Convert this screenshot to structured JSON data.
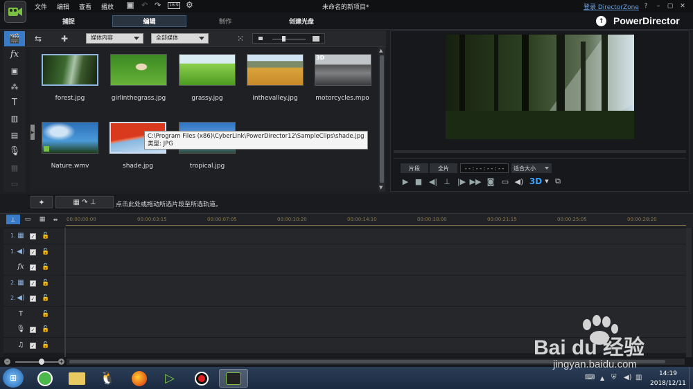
{
  "menu": [
    "文件",
    "编辑",
    "查看",
    "播放"
  ],
  "window": {
    "title": "未命名的新项目*",
    "login": "登录 DirectorZone",
    "help": "?"
  },
  "tabs": [
    {
      "label": "捕捉"
    },
    {
      "label": "编辑"
    },
    {
      "label": "制作"
    },
    {
      "label": "创建光盘"
    }
  ],
  "brand": "PowerDirector",
  "library": {
    "filter1": "媒体内容",
    "filter2": "全部媒体"
  },
  "media": [
    {
      "name": "forest.jpg",
      "badge": ""
    },
    {
      "name": "girlinthegrass.jpg",
      "badge": ""
    },
    {
      "name": "grassy.jpg",
      "badge": ""
    },
    {
      "name": "inthevalley.jpg",
      "badge": ""
    },
    {
      "name": "motorcycles.mpo",
      "badge": "3D"
    },
    {
      "name": "Nature.wmv",
      "badge": ""
    },
    {
      "name": "shade.jpg",
      "badge": ""
    },
    {
      "name": "tropical.jpg",
      "badge": ""
    }
  ],
  "tooltip": {
    "path": "C:\\Program Files (x86)\\CyberLink\\PowerDirector12\\SampleClips\\shade.jpg",
    "type": "类型: JPG"
  },
  "preview": {
    "clip": "片段",
    "full": "全片",
    "timecode": "- - : - - : - - : - -",
    "fit": "适合大小",
    "mode3d": "3D"
  },
  "actions": {
    "hint": "点击此处或拖动所选片段至所选轨道。"
  },
  "timeline": {
    "ticks": [
      "00:00:00:00",
      "00:00:03:15",
      "00:00:07:05",
      "00:00:10:20",
      "00:00:14:10",
      "00:00:18:00",
      "00:00:21:15",
      "00:00:25:05",
      "00:00:28:20"
    ]
  },
  "tracks": [
    {
      "label": "1.",
      "icon": "video-track-icon",
      "glyph": "▦",
      "check": true
    },
    {
      "label": "1.",
      "icon": "audio-track-icon",
      "glyph": "◀)",
      "check": true
    },
    {
      "label": "",
      "icon": "fx-track-icon",
      "glyph": "fx",
      "check": true
    },
    {
      "label": "2.",
      "icon": "video-track-icon",
      "glyph": "▦",
      "check": true
    },
    {
      "label": "2.",
      "icon": "audio-track-icon",
      "glyph": "◀)",
      "check": true
    },
    {
      "label": "",
      "icon": "title-track-icon",
      "glyph": "T",
      "check": false
    },
    {
      "label": "",
      "icon": "voice-track-icon",
      "glyph": "🎙",
      "check": true
    },
    {
      "label": "",
      "icon": "music-track-icon",
      "glyph": "♫",
      "check": true
    }
  ],
  "taskbar": {
    "time": "14:19",
    "date": "2018/12/11"
  },
  "watermark": {
    "logo": "Bai du 经验",
    "url": "jingyan.baidu.com"
  },
  "colors": {
    "accent": "#3e5d78",
    "selected": "#8fb5e0",
    "tick": "#8a7a50"
  }
}
